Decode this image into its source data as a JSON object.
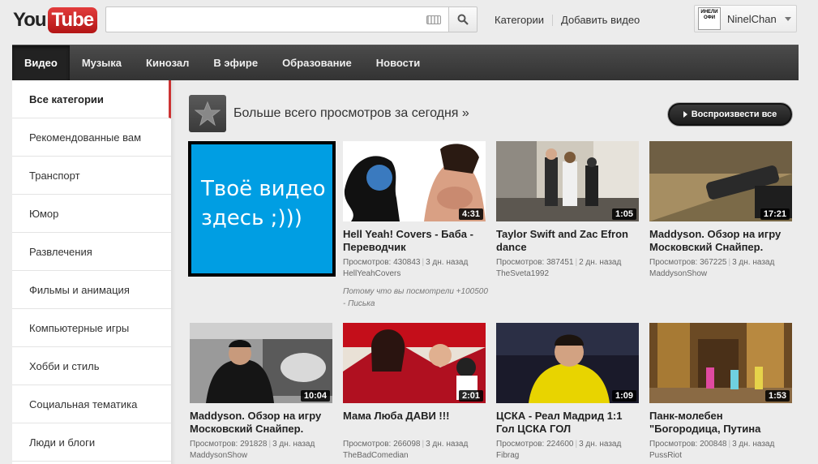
{
  "header": {
    "logo_you": "You",
    "logo_tube": "Tube",
    "search": {
      "value": "",
      "placeholder": ""
    },
    "links": [
      "Категории",
      "Добавить видео"
    ],
    "user": {
      "avatar_text": "ИНЕЛИ ОФИ",
      "name": "NinelChan"
    }
  },
  "nav": {
    "tabs": [
      "Видео",
      "Музыка",
      "Кинозал",
      "В эфире",
      "Образование",
      "Новости"
    ],
    "active": "Видео"
  },
  "sidebar": {
    "items": [
      "Все категории",
      "Рекомендованные вам",
      "Транспорт",
      "Юмор",
      "Развлечения",
      "Фильмы и анимация",
      "Компьютерные игры",
      "Хобби и стиль",
      "Социальная тематика",
      "Люди и блоги"
    ],
    "active": "Все категории"
  },
  "feed": {
    "title": "Больше всего просмотров за сегодня »",
    "play_all": "Воспроизвести все",
    "promo_text": "Твоё видео здесь ;)))",
    "promo_color": "#009ee3",
    "videos": [
      {
        "title": "Hell Yeah! Covers - Баба - Переводчик",
        "duration": "4:31",
        "views_label": "Просмотров:",
        "views": "430843",
        "age": "3 дн. назад",
        "channel": "HellYeahCovers",
        "reason": "Потому что вы посмотрели +100500 - Писька"
      },
      {
        "title": "Taylor Swift and Zac Efron dance",
        "duration": "1:05",
        "views_label": "Просмотров:",
        "views": "387451",
        "age": "2 дн. назад",
        "channel": "TheSveta1992"
      },
      {
        "title": "Maddyson. Обзор на игру Московский Снайпер.",
        "duration": "17:21",
        "views_label": "Просмотров:",
        "views": "367225",
        "age": "3 дн. назад",
        "channel": "MaddysonShow"
      },
      {
        "title": "Maddyson. Обзор на игру Московский Снайпер.",
        "duration": "10:04",
        "views_label": "Просмотров:",
        "views": "291828",
        "age": "3 дн. назад",
        "channel": "MaddysonShow"
      },
      {
        "title": "Мама Люба ДАВИ !!!",
        "duration": "2:01",
        "views_label": "Просмотров:",
        "views": "266098",
        "age": "3 дн. назад",
        "channel": "TheBadComedian"
      },
      {
        "title": "ЦСКА - Реал Мадрид 1:1 Гол ЦСКА ГОЛ",
        "duration": "1:09",
        "views_label": "Просмотров:",
        "views": "224600",
        "age": "3 дн. назад",
        "channel": "Fibrag"
      },
      {
        "title": "Панк-молебен \"Богородица, Путина",
        "duration": "1:53",
        "views_label": "Просмотров:",
        "views": "200848",
        "age": "3 дн. назад",
        "channel": "PussRiot"
      }
    ]
  },
  "colors": {
    "logo_red": "#cc1e1e",
    "nav_bg": "#333333",
    "active_marker": "#cc3333"
  }
}
